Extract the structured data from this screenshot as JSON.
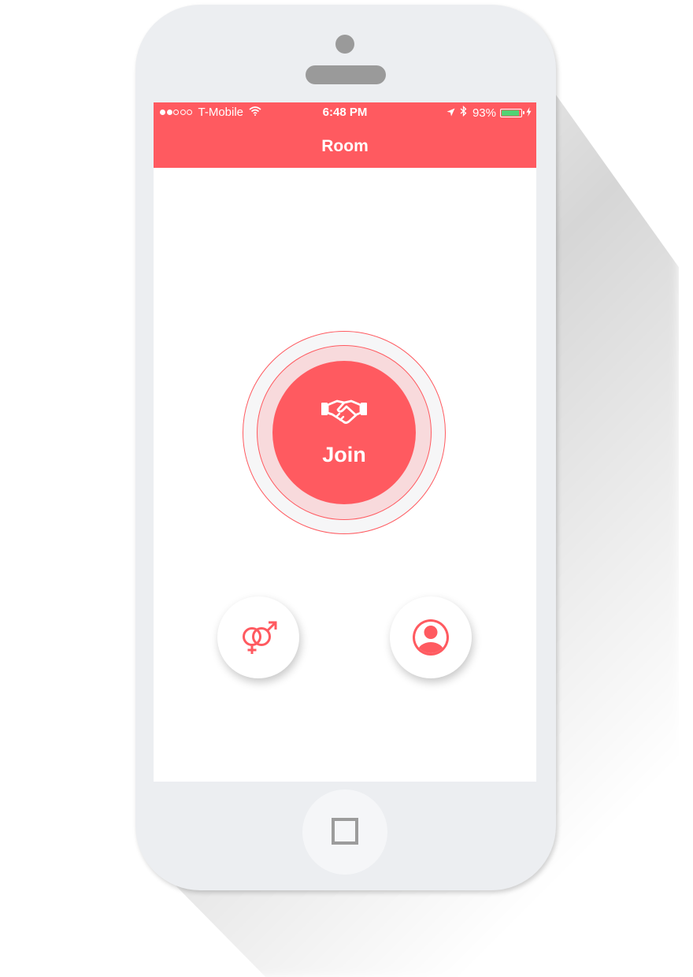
{
  "status_bar": {
    "signal_bars": 5,
    "signal_filled": 2,
    "carrier": "T-Mobile",
    "time": "6:48 PM",
    "battery_percent": "93%",
    "battery_level": 0.93
  },
  "nav": {
    "title": "Room"
  },
  "main": {
    "join_label": "Join",
    "join_icon": "handshake-icon",
    "left_button_icon": "gender-symbols-icon",
    "right_button_icon": "user-profile-icon"
  },
  "device": {
    "home_button_icon": "square-icon"
  },
  "colors": {
    "accent": "#ff5a60",
    "ring_tint": "#f8dadc",
    "battery_green": "#52d273",
    "phone_body": "#eceef1"
  }
}
